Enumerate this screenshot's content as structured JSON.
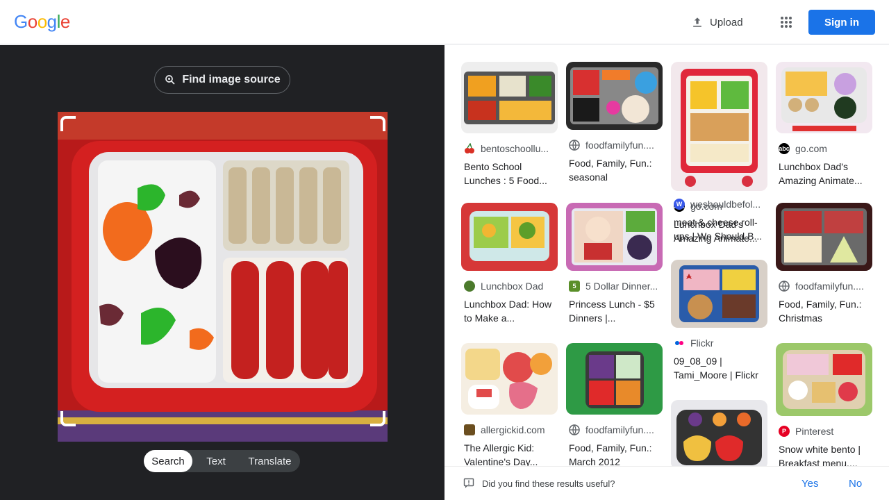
{
  "header": {
    "logo": [
      "G",
      "o",
      "o",
      "g",
      "l",
      "e"
    ],
    "logo_colors": [
      "#4285f4",
      "#ea4335",
      "#fbbc05",
      "#4285f4",
      "#34a853",
      "#ea4335"
    ],
    "upload_label": "Upload",
    "apps_icon": "apps-grid-icon",
    "signin_label": "Sign in"
  },
  "left_panel": {
    "find_source_label": "Find image source",
    "modes": [
      "Search",
      "Text",
      "Translate"
    ],
    "active_mode": "Search"
  },
  "results": [
    {
      "source": "bentoschoollu...",
      "title": "Bento School Lunches : 5 Food...",
      "favicon": "cherry-icon",
      "fav_color": "#d93025"
    },
    {
      "source": "foodfamilyfun....",
      "title": "Food, Family, Fun.: seasonal",
      "favicon": "globe-icon",
      "fav_color": "#5f6368"
    },
    {
      "source": "go.com",
      "title": "Lunchbox Dad's Amazing Animate...",
      "favicon": "abc-icon",
      "fav_color": "#000000"
    },
    {
      "source": "weshouldbefol...",
      "title": "meat & cheese roll-ups | We Should B...",
      "favicon": "w-icon",
      "fav_color": "#3858e9"
    },
    {
      "source": "Lunchbox Dad",
      "title": "Lunchbox Dad: How to Make a...",
      "favicon": "lunchbox-dad-icon",
      "fav_color": "#4b7a2c"
    },
    {
      "source": "5 Dollar Dinner...",
      "title": "Princess Lunch - $5 Dinners |...",
      "favicon": "five-dollar-icon",
      "fav_color": "#5a8f29"
    },
    {
      "source": "foodfamilyfun....",
      "title": "Food, Family, Fun.: Christmas",
      "favicon": "globe-icon",
      "fav_color": "#5f6368"
    },
    {
      "source": "Flickr",
      "title": "09_08_09 | Tami_Moore | Flickr",
      "favicon": "flickr-icon",
      "fav_color": "#ff0084"
    },
    {
      "source": "allergickid.com",
      "title": "The Allergic Kid: Valentine's Day...",
      "favicon": "allergickid-icon",
      "fav_color": "#6b4e1f"
    },
    {
      "source": "foodfamilyfun....",
      "title": "Food, Family, Fun.: March 2012",
      "favicon": "globe-icon",
      "fav_color": "#5f6368"
    },
    {
      "source": "Pinterest",
      "title": "Snow white bento | Breakfast menu....",
      "favicon": "pinterest-icon",
      "fav_color": "#e60023"
    }
  ],
  "feedback": {
    "question": "Did you find these results useful?",
    "yes_label": "Yes",
    "no_label": "No"
  }
}
